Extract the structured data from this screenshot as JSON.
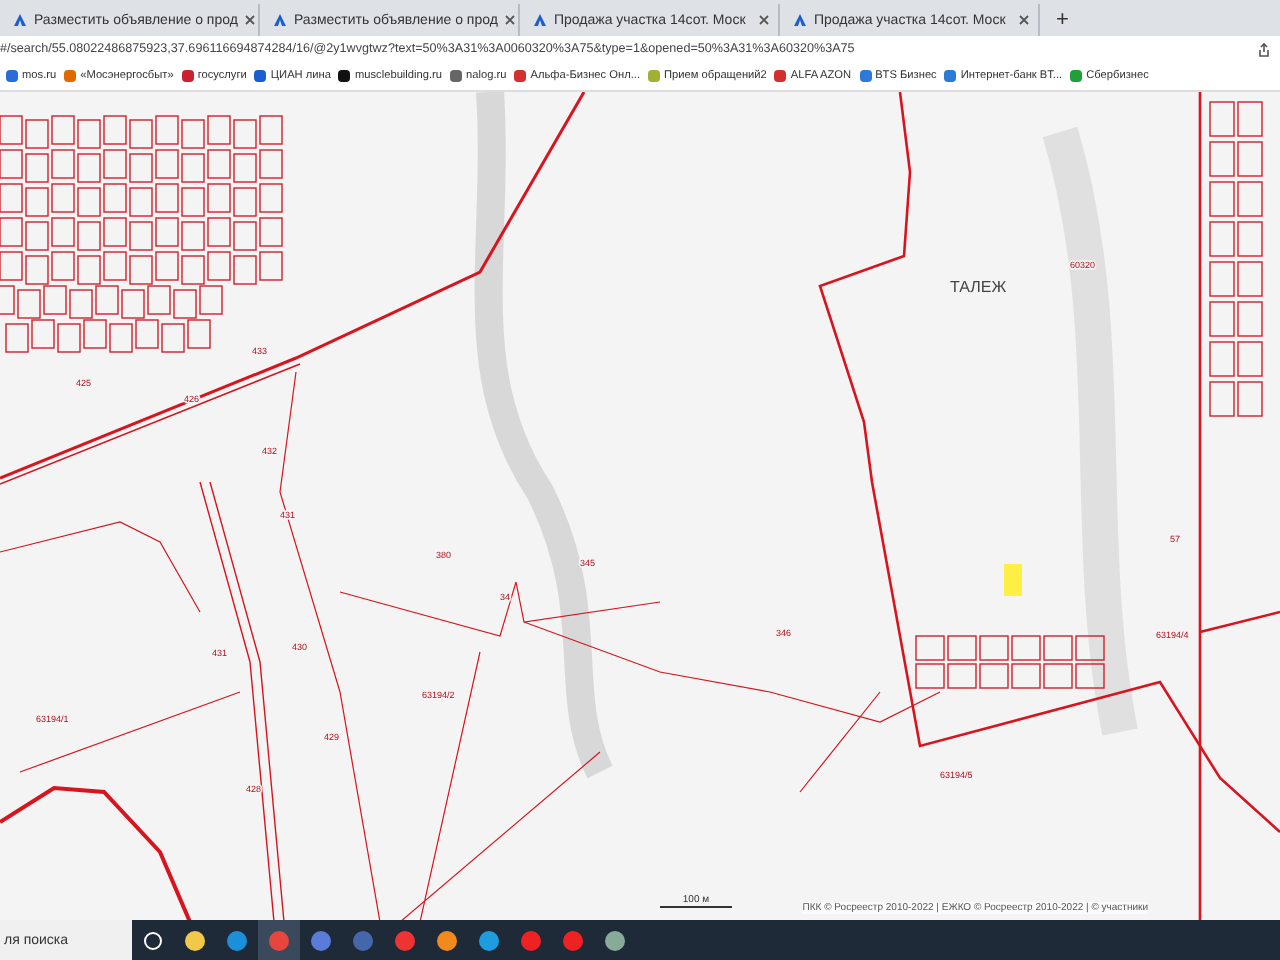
{
  "tabs": [
    {
      "title": "Разместить объявление о прод",
      "selected": false
    },
    {
      "title": "Разместить объявление о прод",
      "selected": false
    },
    {
      "title": "Продажа участка 14сот. Моск",
      "selected": false
    },
    {
      "title": "Продажа участка 14сот. Моск",
      "selected": false
    }
  ],
  "new_tab": "+",
  "address_bar": {
    "value": "#/search/55.08022486875923,37.696116694874284/16/@2y1wvgtwz?text=50%3A31%3A0060320%3A75&type=1&opened=50%3A31%3A60320%3A75"
  },
  "bookmarks": [
    "mos.ru",
    "«Мосэнергосбыт»",
    "госуслуги",
    "ЦИАН лина",
    "musclebuilding.ru",
    "nalog.ru",
    "Альфа-Бизнес Онл...",
    "Прием обращений2",
    "ALFA AZON",
    "BTS Бизнес",
    "Интернет-банк BT...",
    "Сбербизнес"
  ],
  "map": {
    "place_name": "ТАЛЕЖ",
    "labels": [
      "60320",
      "433",
      "426",
      "425",
      "432",
      "431",
      "431",
      "380",
      "345",
      "34",
      "63194/1",
      "63194/2",
      "63194/5",
      "63194/4",
      "429",
      "428",
      "57",
      "430",
      "346"
    ],
    "scale": "100 м",
    "attribution": "ПКК © Росреестр 2010-2022 | ЕЖКО © Росреестр 2010-2022 | © участники"
  },
  "taskbar": {
    "search_placeholder": "ля поиска"
  }
}
